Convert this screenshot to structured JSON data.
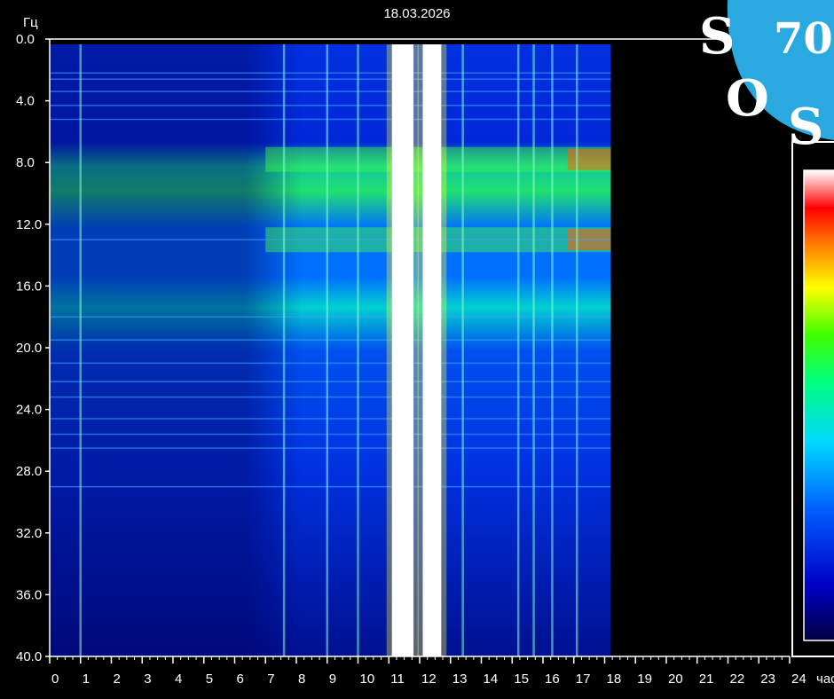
{
  "chart_data": {
    "type": "heatmap",
    "title": "18.03.2026",
    "ylabel": "Гц",
    "xlabel": "час",
    "xlim": [
      0,
      24
    ],
    "ylim": [
      0,
      40
    ],
    "x_ticks": [
      0,
      1,
      2,
      3,
      4,
      5,
      6,
      7,
      8,
      9,
      10,
      11,
      12,
      13,
      14,
      15,
      16,
      17,
      18,
      19,
      20,
      21,
      22,
      23,
      24
    ],
    "y_ticks": [
      "0.0",
      "4.0",
      "8.0",
      "12.0",
      "16.0",
      "20.0",
      "24.0",
      "28.0",
      "32.0",
      "36.0",
      "40.0"
    ],
    "data_end_hour": 18.2,
    "colormap": [
      "#000040",
      "#0000c8",
      "#0060ff",
      "#00d8ff",
      "#00ff80",
      "#40ff00",
      "#ffff00",
      "#ff8000",
      "#ff0000",
      "#ffffff"
    ],
    "bright_bands_hours": [
      [
        11.1,
        11.8
      ],
      [
        12.1,
        12.7
      ]
    ],
    "resonance_bands_hz": [
      7.8,
      13.0
    ]
  },
  "logo": {
    "bg_color": "#29a9e0",
    "text_number": "70",
    "letters": [
      "S",
      "O",
      "S"
    ]
  }
}
